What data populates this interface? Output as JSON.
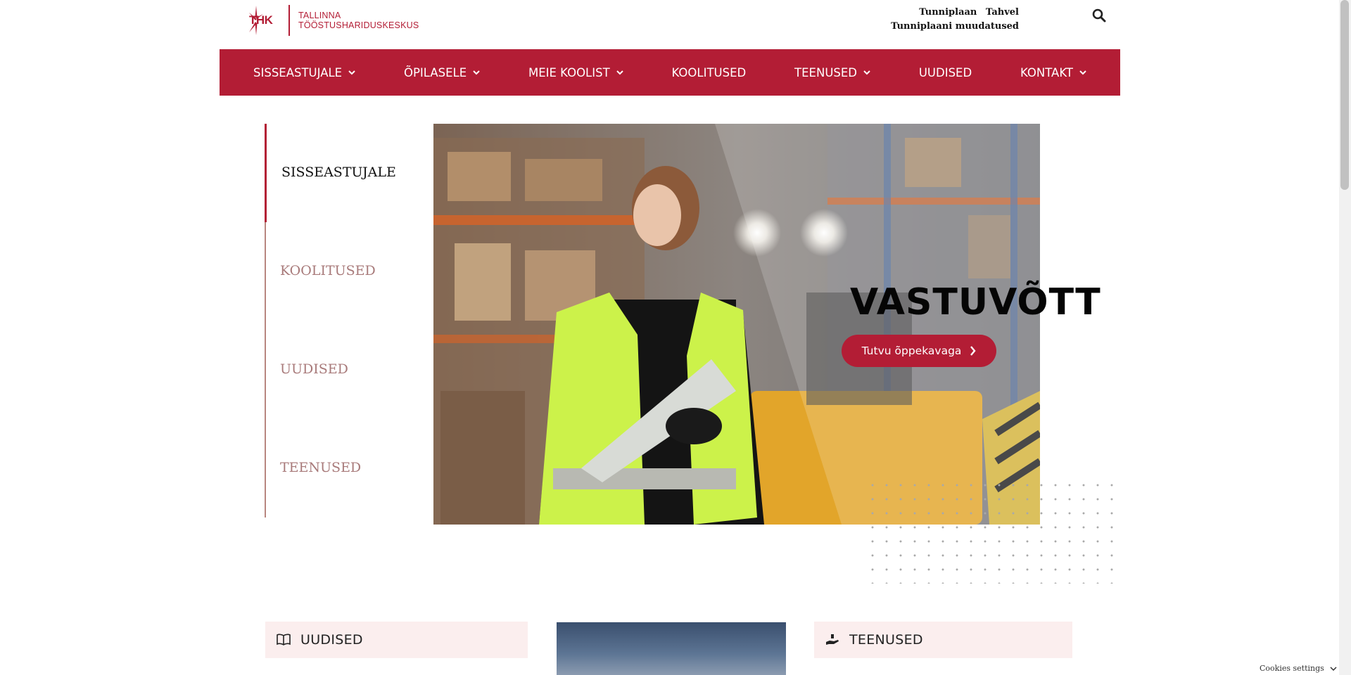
{
  "header": {
    "logo": {
      "abbr": "THK",
      "line1": "TALLINNA",
      "line2": "TÖÖSTUSHARIDUSKESKUS"
    },
    "top_links": [
      "Tunniplaan",
      "Tahvel"
    ],
    "top_link_2": "Tunniplaani muudatused",
    "search_icon": "search-icon"
  },
  "nav": {
    "items": [
      {
        "label": "SISSEASTUJALE",
        "dropdown": true
      },
      {
        "label": "ÕPILASELE",
        "dropdown": true
      },
      {
        "label": "MEIE KOOLIST",
        "dropdown": true
      },
      {
        "label": "KOOLITUSED",
        "dropdown": false
      },
      {
        "label": "TEENUSED",
        "dropdown": true
      },
      {
        "label": "UUDISED",
        "dropdown": false
      },
      {
        "label": "KONTAKT",
        "dropdown": true
      }
    ]
  },
  "side_menu": {
    "items": [
      {
        "label": "SISSEASTUJALE",
        "active": true
      },
      {
        "label": "KOOLITUSED",
        "active": false
      },
      {
        "label": "UUDISED",
        "active": false
      },
      {
        "label": "TEENUSED",
        "active": false
      }
    ]
  },
  "hero": {
    "title": "VASTUVÕTT",
    "button_label": "Tutvu õppekavaga"
  },
  "cards": {
    "news": {
      "title": "UUDISED",
      "icon": "book-icon"
    },
    "services": {
      "title": "TEENUSED",
      "icon": "hand-holding-icon"
    }
  },
  "cookies": {
    "label": "Cookies settings"
  },
  "colors": {
    "brand": "#b31d35",
    "side_inactive": "#a87a7a",
    "card_bg": "#fbeeee"
  }
}
